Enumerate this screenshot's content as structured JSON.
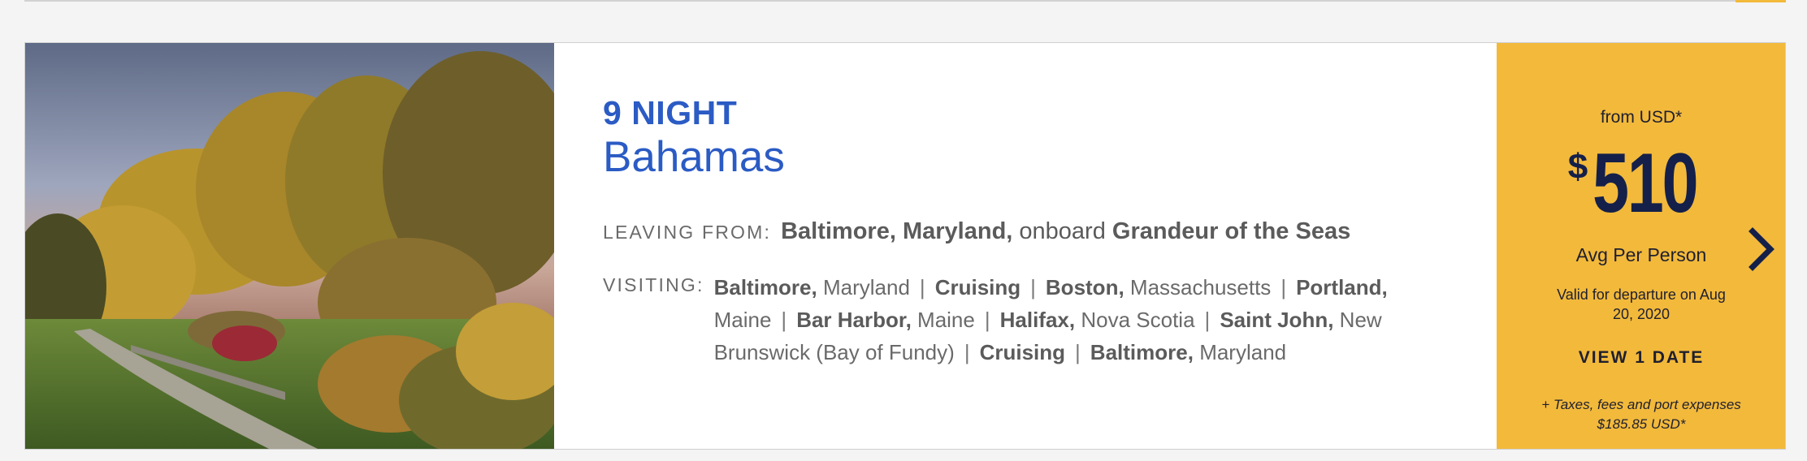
{
  "card": {
    "nights": "9 NIGHT",
    "region": "Bahamas",
    "leaving_label": "LEAVING FROM:",
    "leaving_port": "Baltimore, Maryland,",
    "onboard": "onboard",
    "ship": "Grandeur of the Seas",
    "visiting_label": "VISITING:",
    "ports": [
      {
        "bold": "Baltimore,",
        "rest": "Maryland"
      },
      {
        "bold": "Cruising",
        "rest": ""
      },
      {
        "bold": "Boston,",
        "rest": "Massachusetts"
      },
      {
        "bold": "Portland,",
        "rest": "Maine"
      },
      {
        "bold": "Bar Harbor,",
        "rest": "Maine"
      },
      {
        "bold": "Halifax,",
        "rest": "Nova Scotia"
      },
      {
        "bold": "Saint John,",
        "rest": "New Brunswick (Bay of Fundy)"
      },
      {
        "bold": "Cruising",
        "rest": ""
      },
      {
        "bold": "Baltimore,",
        "rest": "Maryland"
      }
    ],
    "separator": "|"
  },
  "price": {
    "from_label": "from USD*",
    "currency": "$",
    "amount": "510",
    "avg_label": "Avg Per Person",
    "valid_text": "Valid for departure on Aug 20, 2020",
    "view_dates": "VIEW 1 DATE",
    "taxes_note": "+ Taxes, fees and port expenses $185.85 USD*"
  },
  "icons": {
    "next": "chevron-right-icon"
  },
  "colors": {
    "accent_blue": "#2b5bc4",
    "price_panel": "#f2b93b",
    "price_text": "#14204a"
  }
}
